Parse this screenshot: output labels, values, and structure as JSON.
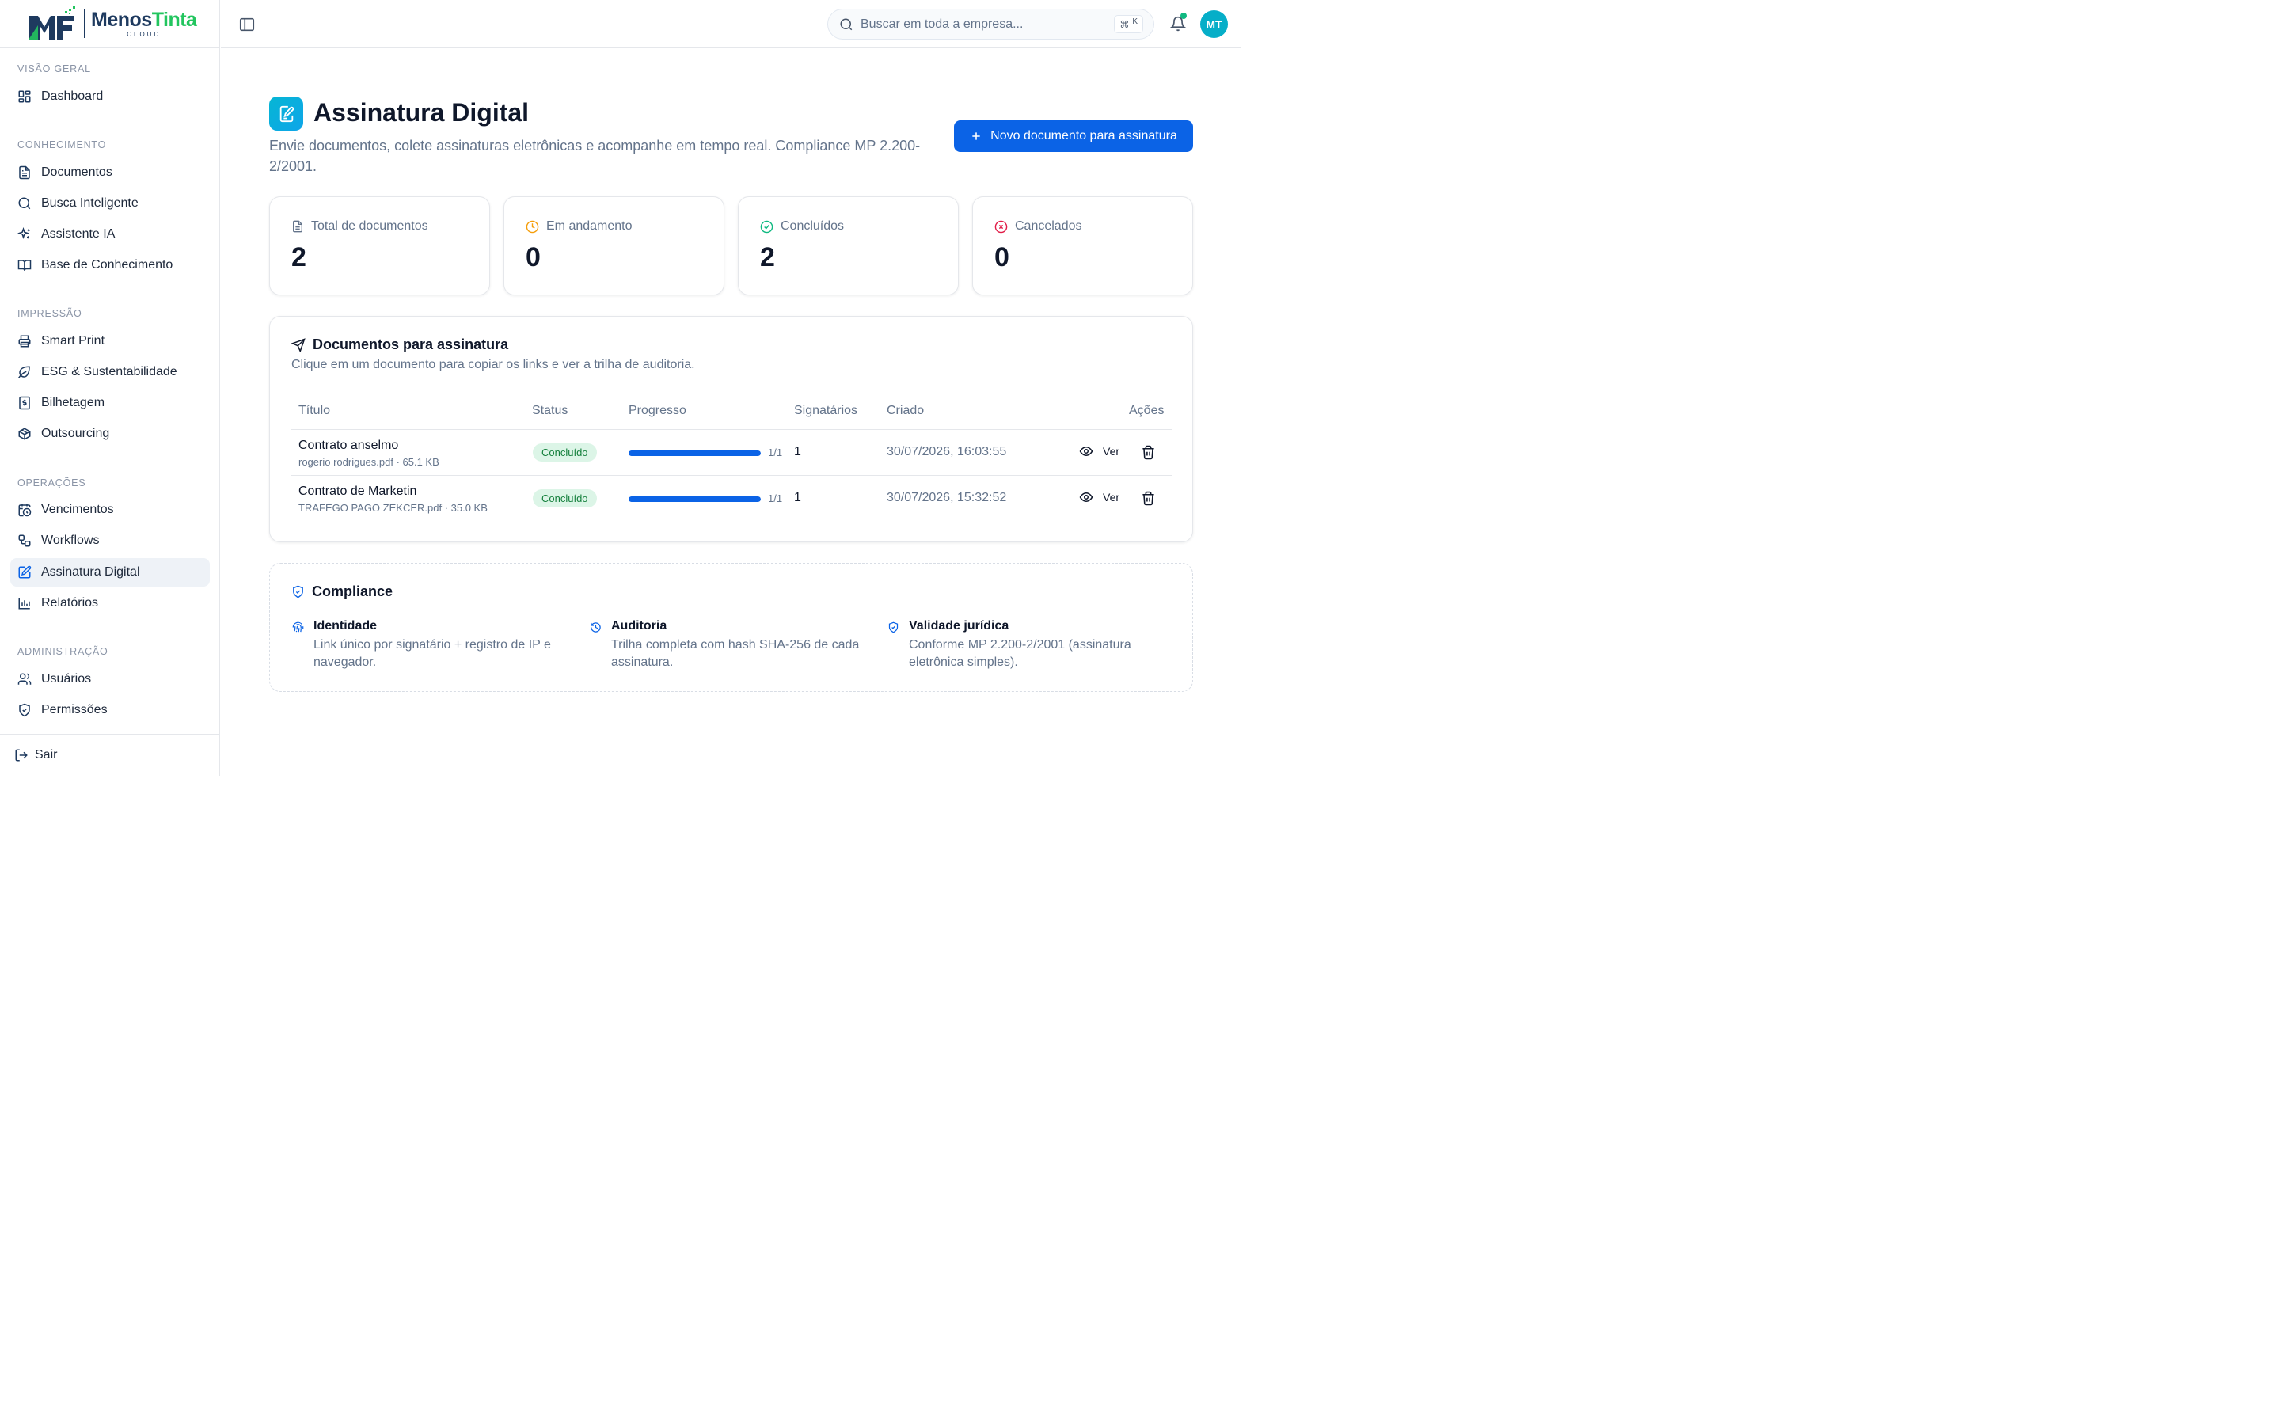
{
  "app": {
    "brand_left": "Menos",
    "brand_right": "Tinta",
    "brand_sub": "CLOUD",
    "brand_colors": {
      "primary": "#1e3a5f",
      "accent": "#22c55e"
    }
  },
  "sidebar": {
    "sections": [
      {
        "label": "VISÃO GERAL",
        "items": [
          {
            "label": "Dashboard",
            "icon": "dashboard-icon"
          }
        ]
      },
      {
        "label": "CONHECIMENTO",
        "items": [
          {
            "label": "Documentos",
            "icon": "document-icon"
          },
          {
            "label": "Busca Inteligente",
            "icon": "search-icon"
          },
          {
            "label": "Assistente IA",
            "icon": "sparkles-icon"
          },
          {
            "label": "Base de Conhecimento",
            "icon": "book-icon"
          }
        ]
      },
      {
        "label": "IMPRESSÃO",
        "items": [
          {
            "label": "Smart Print",
            "icon": "printer-icon"
          },
          {
            "label": "ESG & Sustentabilidade",
            "icon": "leaf-icon"
          },
          {
            "label": "Bilhetagem",
            "icon": "receipt-icon"
          },
          {
            "label": "Outsourcing",
            "icon": "package-icon"
          }
        ]
      },
      {
        "label": "OPERAÇÕES",
        "items": [
          {
            "label": "Vencimentos",
            "icon": "calendar-clock-icon"
          },
          {
            "label": "Workflows",
            "icon": "workflow-icon"
          },
          {
            "label": "Assinatura Digital",
            "icon": "signature-icon",
            "active": true
          },
          {
            "label": "Relatórios",
            "icon": "bar-chart-icon"
          }
        ]
      },
      {
        "label": "ADMINISTRAÇÃO",
        "items": [
          {
            "label": "Usuários",
            "icon": "users-icon"
          },
          {
            "label": "Permissões",
            "icon": "shield-icon"
          }
        ]
      }
    ],
    "logout_label": "Sair"
  },
  "header": {
    "search_placeholder": "Buscar em toda a empresa...",
    "shortcut_symbol": "⌘",
    "shortcut_key": "K",
    "avatar_initials": "MT",
    "notification_dot_color": "#10b981"
  },
  "page": {
    "title": "Assinatura Digital",
    "subtitle": "Envie documentos, colete assinaturas eletrônicas e acompanhe em tempo real. Compliance MP 2.200-2/2001.",
    "new_button_label": "Novo documento para assinatura"
  },
  "stats": [
    {
      "label": "Total de documentos",
      "value": "2",
      "icon": "file-icon",
      "color": "#64748b"
    },
    {
      "label": "Em andamento",
      "value": "0",
      "icon": "clock-icon",
      "color": "#f59e0b"
    },
    {
      "label": "Concluídos",
      "value": "2",
      "icon": "check-circle-icon",
      "color": "#10b981"
    },
    {
      "label": "Cancelados",
      "value": "0",
      "icon": "x-circle-icon",
      "color": "#e11d48"
    }
  ],
  "documents": {
    "title": "Documentos para assinatura",
    "subtitle": "Clique em um documento para copiar os links e ver a trilha de auditoria.",
    "columns": [
      "Título",
      "Status",
      "Progresso",
      "Signatários",
      "Criado",
      "Ações"
    ],
    "rows": [
      {
        "title": "Contrato anselmo",
        "meta": "rogerio rodrigues.pdf · 65.1 KB",
        "status": "Concluído",
        "progress": 1.0,
        "progress_text": "1/1",
        "signers": "1",
        "created": "30/07/2026, 16:03:55",
        "view_label": "Ver"
      },
      {
        "title": "Contrato de Marketin",
        "meta": "TRAFEGO PAGO ZEKCER.pdf · 35.0 KB",
        "status": "Concluído",
        "progress": 1.0,
        "progress_text": "1/1",
        "signers": "1",
        "created": "30/07/2026, 15:32:52",
        "view_label": "Ver"
      }
    ]
  },
  "compliance": {
    "title": "Compliance",
    "items": [
      {
        "title": "Identidade",
        "description": "Link único por signatário + registro de IP e navegador.",
        "icon": "fingerprint-icon"
      },
      {
        "title": "Auditoria",
        "description": "Trilha completa com hash SHA-256 de cada assinatura.",
        "icon": "history-icon"
      },
      {
        "title": "Validade jurídica",
        "description": "Conforme MP 2.200-2/2001 (assinatura eletrônica simples).",
        "icon": "shield-check-icon"
      }
    ]
  }
}
